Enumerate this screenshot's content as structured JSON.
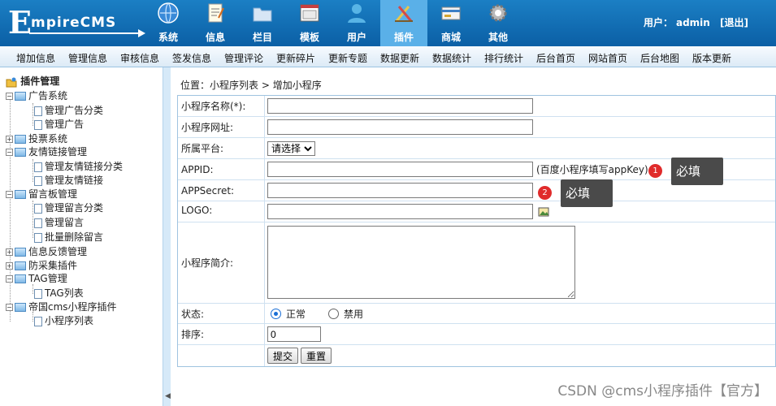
{
  "app": {
    "logo_e": "E",
    "logo_rest": "mpireCMS"
  },
  "topnav": [
    {
      "label": "系统",
      "icon": "globe-icon"
    },
    {
      "label": "信息",
      "icon": "document-icon"
    },
    {
      "label": "栏目",
      "icon": "folder-icon"
    },
    {
      "label": "模板",
      "icon": "template-window-icon"
    },
    {
      "label": "用户",
      "icon": "user-icon"
    },
    {
      "label": "插件",
      "icon": "tools-icon",
      "active": true
    },
    {
      "label": "商城",
      "icon": "card-icon"
    },
    {
      "label": "其他",
      "icon": "gear-icon"
    }
  ],
  "user": {
    "label": "用户：",
    "name": "admin",
    "logout": "[退出]"
  },
  "menubar": [
    "增加信息",
    "管理信息",
    "审核信息",
    "签发信息",
    "管理评论",
    "更新碎片",
    "更新专题",
    "数据更新",
    "数据统计",
    "排行统计",
    "后台首页",
    "网站首页",
    "后台地图",
    "版本更新"
  ],
  "sidebar": {
    "title": "插件管理",
    "items": [
      "广告系统",
      "管理广告分类",
      "管理广告",
      "投票系统",
      "友情链接管理",
      "管理友情链接分类",
      "管理友情链接",
      "留言板管理",
      "管理留言分类",
      "管理留言",
      "批量删除留言",
      "信息反馈管理",
      "防采集插件",
      "TAG管理",
      "TAG列表",
      "帝国cms小程序插件",
      "小程序列表"
    ]
  },
  "breadcrumb": {
    "prefix": "位置：",
    "link": "小程序列表",
    "sep": " > ",
    "current": "增加小程序"
  },
  "form": {
    "name_label": "小程序名称(*):",
    "url_label": "小程序网址:",
    "platform_label": "所属平台:",
    "platform_selected": "请选择",
    "appid_label": "APPID:",
    "appid_hint": "(百度小程序填写appKey)",
    "appsecret_label": "APPSecret:",
    "logo_label": "LOGO:",
    "intro_label": "小程序简介:",
    "status_label": "状态:",
    "status_on": "正常",
    "status_off": "禁用",
    "order_label": "排序:",
    "order_value": "0",
    "submit": "提交",
    "reset": "重置"
  },
  "annotations": [
    {
      "num": "1",
      "text": "必填"
    },
    {
      "num": "2",
      "text": "必填"
    }
  ],
  "watermark": "CSDN @cms小程序插件【官方】"
}
